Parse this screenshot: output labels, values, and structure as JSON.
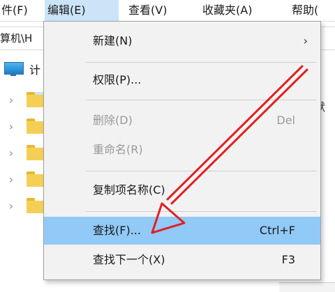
{
  "menubar": {
    "items": [
      {
        "label": "件(F)"
      },
      {
        "label": "编辑(E)"
      },
      {
        "label": "查看(V)"
      },
      {
        "label": "收藏夹(A)"
      },
      {
        "label": "帮助("
      }
    ]
  },
  "address": {
    "path": "算机\\H"
  },
  "tree": {
    "computer_label": "计",
    "side_text": "默"
  },
  "edit_menu": {
    "new": {
      "label": "新建(N)",
      "arrow": "›"
    },
    "permissions": {
      "label": "权限(P)..."
    },
    "delete": {
      "label": "删除(D)",
      "shortcut": "Del"
    },
    "rename": {
      "label": "重命名(R)"
    },
    "copy_key_name": {
      "label": "复制项名称(C)"
    },
    "find": {
      "label": "查找(F)...",
      "shortcut": "Ctrl+F"
    },
    "find_next": {
      "label": "查找下一个(X)",
      "shortcut": "F3"
    }
  },
  "colors": {
    "highlight": "#91c9f7",
    "menubar_active": "#cce4f7",
    "annotation_arrow": "#e02020",
    "folder": "#f5cf55"
  }
}
